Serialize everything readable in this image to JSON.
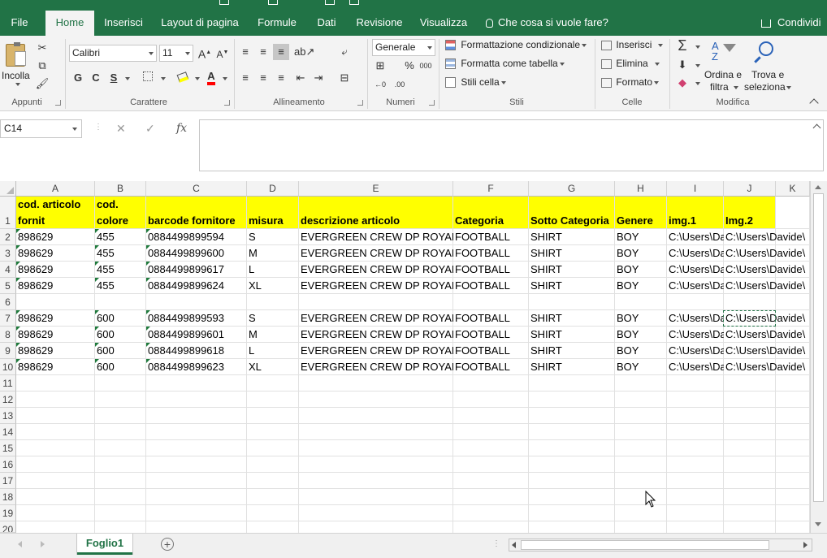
{
  "ribbon_tabs": [
    "File",
    "Home",
    "Inserisci",
    "Layout di pagina",
    "Formule",
    "Dati",
    "Revisione",
    "Visualizza"
  ],
  "tell_me": "Che cosa si vuole fare?",
  "share": "Condividi",
  "ribbon": {
    "clipboard": {
      "label": "Appunti",
      "paste": "Incolla"
    },
    "font": {
      "label": "Carattere",
      "font_name": "Calibri",
      "font_size": "11",
      "bold": "G",
      "italic": "C",
      "underline": "S"
    },
    "alignment": {
      "label": "Allineamento"
    },
    "number": {
      "label": "Numeri",
      "format": "Generale"
    },
    "styles": {
      "label": "Stili",
      "conditional": "Formattazione condizionale",
      "format_table": "Formatta come tabella",
      "cell_styles": "Stili cella"
    },
    "cells": {
      "label": "Celle",
      "insert": "Inserisci",
      "delete": "Elimina",
      "format": "Formato"
    },
    "editing": {
      "label": "Modifica",
      "sort_l1": "Ordina e",
      "sort_l2": "filtra",
      "find_l1": "Trova e",
      "find_l2": "seleziona"
    }
  },
  "name_box": "C14",
  "fx_label": "fx",
  "columns": [
    "A",
    "B",
    "C",
    "D",
    "E",
    "F",
    "G",
    "H",
    "I",
    "J",
    "K"
  ],
  "row_numbers": [
    "1",
    "2",
    "3",
    "4",
    "5",
    "6",
    "7",
    "8",
    "9",
    "10",
    "11",
    "12",
    "13",
    "14",
    "15",
    "16",
    "17",
    "18",
    "19",
    "20"
  ],
  "header_row": {
    "a1": "cod. articolo",
    "a2": "fornit",
    "b1": "cod.",
    "b2": "colore",
    "c": "barcode fornitore",
    "d": "misura",
    "e": "descrizione articolo",
    "f": "Categoria",
    "g": "Sotto Categoria",
    "h": "Genere",
    "i": "img.1",
    "j": "Img.2"
  },
  "rows": [
    [
      "898629",
      "455",
      "0884499899594",
      "S",
      "EVERGREEN CREW   DP ROYAL",
      "FOOTBALL",
      "SHIRT",
      "BOY",
      "C:\\Users\\Da",
      "C:\\Users\\Davide\\"
    ],
    [
      "898629",
      "455",
      "0884499899600",
      "M",
      "EVERGREEN CREW   DP ROYAL",
      "FOOTBALL",
      "SHIRT",
      "BOY",
      "C:\\Users\\Da",
      "C:\\Users\\Davide\\"
    ],
    [
      "898629",
      "455",
      "0884499899617",
      "L",
      "EVERGREEN CREW   DP ROYAL",
      "FOOTBALL",
      "SHIRT",
      "BOY",
      "C:\\Users\\Da",
      "C:\\Users\\Davide\\"
    ],
    [
      "898629",
      "455",
      "0884499899624",
      "XL",
      "EVERGREEN CREW   DP ROYAL",
      "FOOTBALL",
      "SHIRT",
      "BOY",
      "C:\\Users\\Da",
      "C:\\Users\\Davide\\"
    ],
    [
      "",
      "",
      "",
      "",
      "",
      "",
      "",
      "",
      "",
      ""
    ],
    [
      "898629",
      "600",
      "0884499899593",
      "S",
      "EVERGREEN CREW   DP ROYAL",
      "FOOTBALL",
      "SHIRT",
      "BOY",
      "C:\\Users\\Da",
      "C:\\Users\\Davide\\"
    ],
    [
      "898629",
      "600",
      "0884499899601",
      "M",
      "EVERGREEN CREW   DP ROYAL",
      "FOOTBALL",
      "SHIRT",
      "BOY",
      "C:\\Users\\Da",
      "C:\\Users\\Davide\\"
    ],
    [
      "898629",
      "600",
      "0884499899618",
      "L",
      "EVERGREEN CREW   DP ROYAL",
      "FOOTBALL",
      "SHIRT",
      "BOY",
      "C:\\Users\\Da",
      "C:\\Users\\Davide\\"
    ],
    [
      "898629",
      "600",
      "0884499899623",
      "XL",
      "EVERGREEN CREW   DP ROYAL",
      "FOOTBALL",
      "SHIRT",
      "BOY",
      "C:\\Users\\Da",
      "C:\\Users\\Davide\\"
    ]
  ],
  "sheet_tab": "Foglio1",
  "colors": {
    "excel_green": "#217346",
    "header_fill": "#ffff00"
  }
}
